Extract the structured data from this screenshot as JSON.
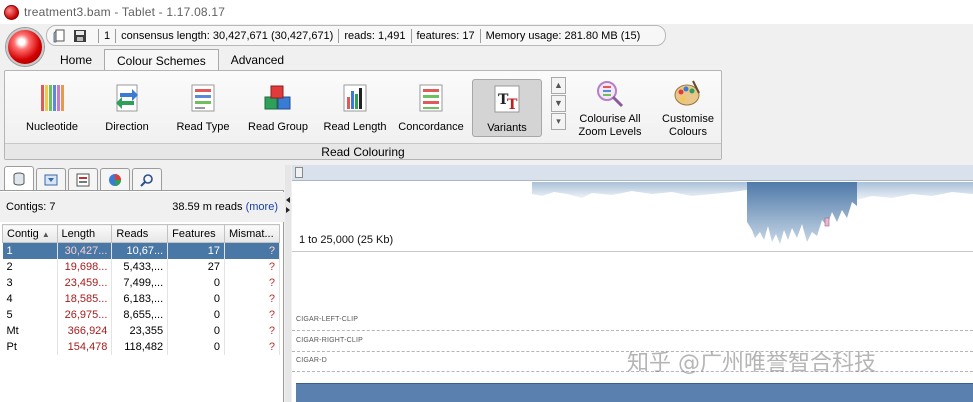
{
  "window": {
    "title": "treatment3.bam - Tablet - 1.17.08.17"
  },
  "quick_access": {
    "contig": "1",
    "consensus": "consensus length: 30,427,671 (30,427,671)",
    "reads": "reads: 1,491",
    "features": "features: 17",
    "memory": "Memory usage: 281.80 MB (15)"
  },
  "tabs": [
    "Home",
    "Colour Schemes",
    "Advanced"
  ],
  "ribbon": {
    "buttons": [
      "Nucleotide",
      "Direction",
      "Read Type",
      "Read Group",
      "Read Length",
      "Concordance",
      "Variants"
    ],
    "colourise_all": [
      "Colourise All",
      "Zoom Levels"
    ],
    "customise": [
      "Customise",
      "Colours"
    ],
    "group_label": "Read Colouring"
  },
  "contigs_panel": {
    "count_label": "Contigs: 7",
    "reads_label": "38.59 m reads",
    "more_label": "(more)",
    "columns": [
      "Contig",
      "Length",
      "Reads",
      "Features",
      "Mismat..."
    ],
    "rows": [
      [
        "1",
        "30,427...",
        "10,67...",
        "17",
        "?"
      ],
      [
        "2",
        "19,698...",
        "5,433,...",
        "27",
        "?"
      ],
      [
        "3",
        "23,459...",
        "7,499,...",
        "0",
        "?"
      ],
      [
        "4",
        "18,585...",
        "6,183,...",
        "0",
        "?"
      ],
      [
        "5",
        "26,975...",
        "8,655,...",
        "0",
        "?"
      ],
      [
        "Mt",
        "366,924",
        "23,355",
        "0",
        "?"
      ],
      [
        "Pt",
        "154,478",
        "118,482",
        "0",
        "?"
      ]
    ]
  },
  "viewer": {
    "range": "1 to 25,000 (25 Kb)",
    "tracks": [
      "CIGAR-LEFT-CLIP",
      "CIGAR-RIGHT-CLIP",
      "CIGAR-D"
    ]
  },
  "watermark": "知乎 @广州唯誉智合科技",
  "colors": {
    "selection": "#4a78a6",
    "coverage": "#4f7aa8",
    "accent_red": "#a81c1c"
  }
}
